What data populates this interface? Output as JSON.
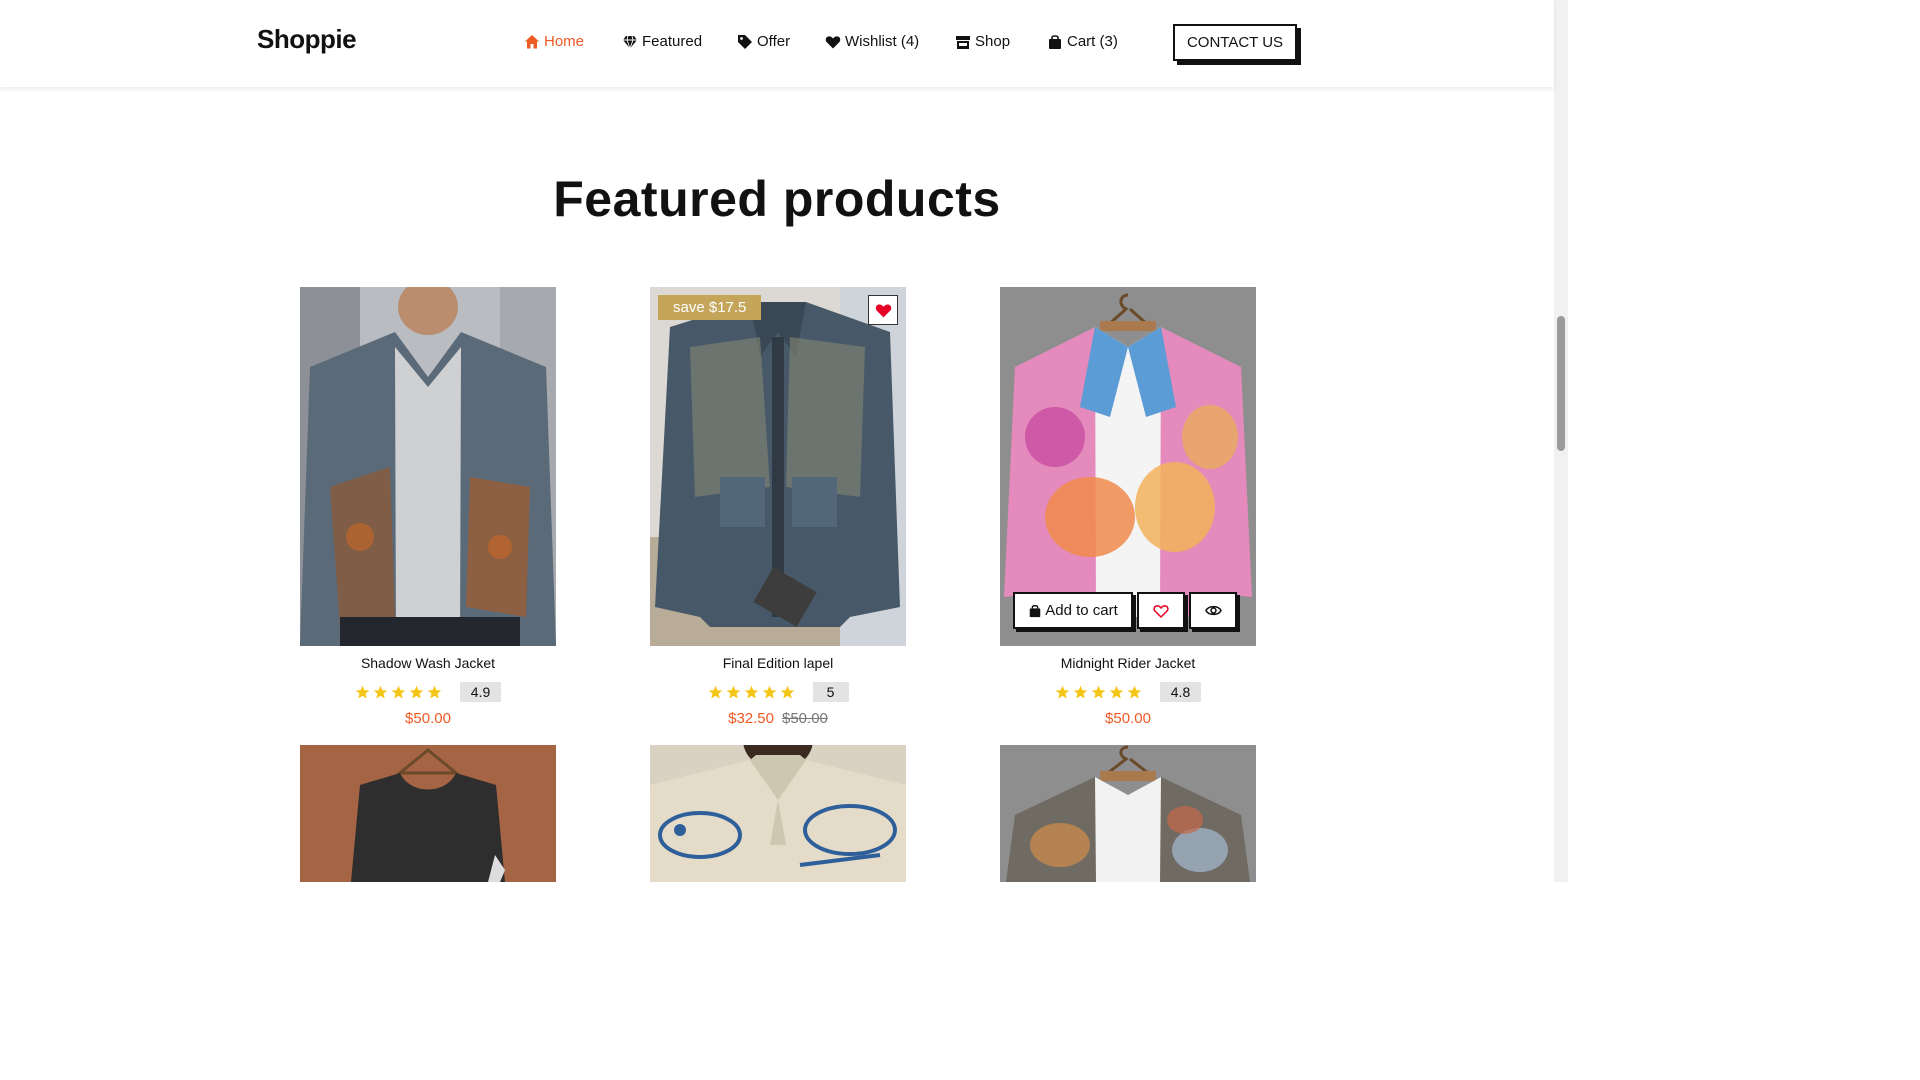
{
  "header": {
    "logo": "Shoppie",
    "nav": [
      {
        "label": "Home",
        "icon": "home-icon",
        "active": true
      },
      {
        "label": "Featured",
        "icon": "diamond-icon"
      },
      {
        "label": "Offer",
        "icon": "tag-icon"
      },
      {
        "label": "Wishlist (4)",
        "icon": "heart-icon"
      },
      {
        "label": "Shop",
        "icon": "store-icon"
      },
      {
        "label": "Cart (3)",
        "icon": "bag-icon"
      }
    ],
    "contact_label": "CONTACT US"
  },
  "section": {
    "title": "Featured products"
  },
  "products": [
    {
      "name": "Shadow Wash Jacket",
      "rating": "4.9",
      "price": "$50.00",
      "old_price": ""
    },
    {
      "name": "Final Edition lapel",
      "rating": "5",
      "price": "$32.50",
      "old_price": "$50.00",
      "badge": "save $17.5",
      "wishlisted": true
    },
    {
      "name": "Midnight Rider Jacket",
      "rating": "4.8",
      "price": "$50.00",
      "old_price": "",
      "hover_actions": {
        "add_to_cart": "Add to cart"
      }
    }
  ],
  "colors": {
    "accent": "#ee5a24",
    "star": "#f5c518",
    "badge": "#c5a55a",
    "wish_red": "#e60023"
  }
}
